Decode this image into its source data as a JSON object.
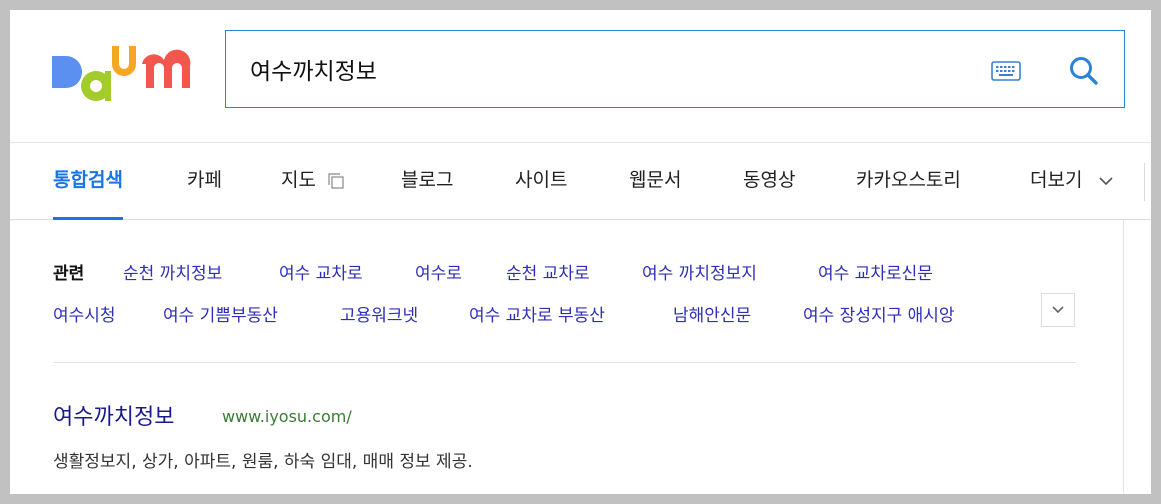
{
  "logo": {
    "text": "Daum"
  },
  "search": {
    "query": "여수까치정보",
    "keyboard_icon": "keyboard-icon",
    "search_icon": "search-icon"
  },
  "tabs": [
    {
      "label": "통합검색",
      "active": true
    },
    {
      "label": "카페"
    },
    {
      "label": "지도"
    },
    {
      "label": "블로그"
    },
    {
      "label": "사이트"
    },
    {
      "label": "웹문서"
    },
    {
      "label": "동영상"
    },
    {
      "label": "카카오스토리"
    },
    {
      "label": "더보기"
    }
  ],
  "related": {
    "label": "관련",
    "items": [
      "순천 까치정보",
      "여수 교차로",
      "여수로",
      "순천 교차로",
      "여수 까치정보지",
      "여수 교차로신문",
      "여수시청",
      "여수 기쁨부동산",
      "고용워크넷",
      "여수 교차로 부동산",
      "남해안신문",
      "여수 장성지구 애시앙"
    ]
  },
  "result": {
    "title": "여수까치정보",
    "url": "www.iyosu.com/",
    "description": "생활정보지, 상가, 아파트, 원룸, 하숙 임대, 매매 정보 제공."
  },
  "colors": {
    "accent": "#1a73e8",
    "link": "#2e2eb8",
    "url_green": "#3a7b35"
  }
}
